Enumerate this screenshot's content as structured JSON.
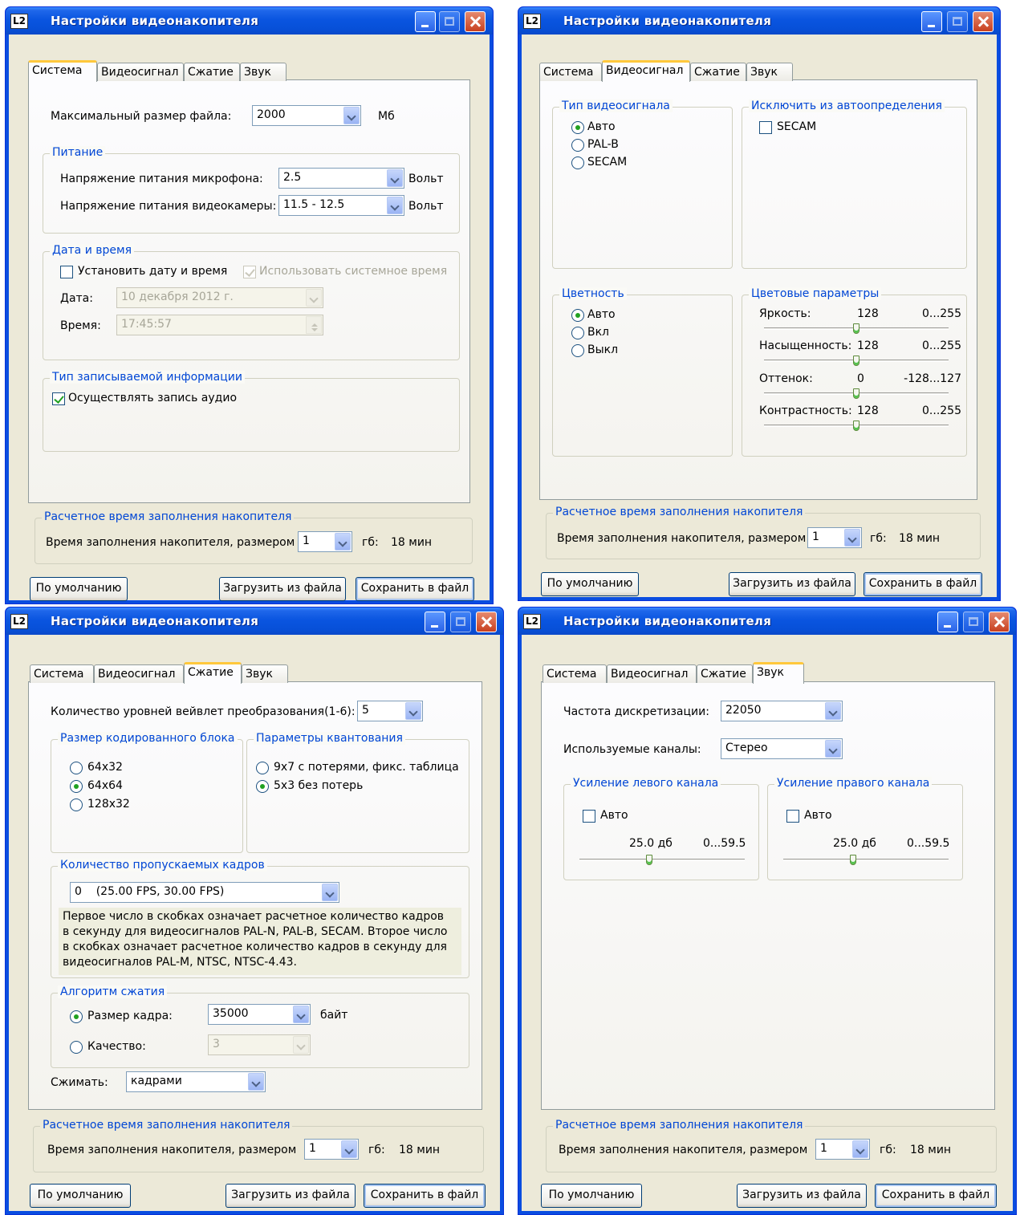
{
  "window": {
    "title": "Настройки видеонакопителя",
    "icon_label": "L2",
    "tabs": [
      "Система",
      "Видеосигнал",
      "Сжатие",
      "Звук"
    ]
  },
  "colors": {
    "titlebar": "#0a55e0",
    "group_title": "#0046d5",
    "face": "#ece9d8",
    "check": "#21a121"
  },
  "footer": {
    "group_title": "Расчетное время заполнения накопителя",
    "fill_label": "Время заполнения накопителя, размером",
    "size_value": "1",
    "unit": "гб:",
    "time": "18 мин",
    "btn_default": "По умолчанию",
    "btn_load": "Загрузить из файла",
    "btn_save": "Сохранить в файл"
  },
  "system": {
    "max_size_label": "Максимальный размер файла:",
    "max_size_value": "2000",
    "max_size_unit": "Мб",
    "power_group": "Питание",
    "mic_label": "Напряжение питания микрофона:",
    "mic_value": "2.5",
    "cam_label": "Напряжение питания видеокамеры:",
    "cam_value": "11.5 - 12.5",
    "volt": "Вольт",
    "datetime_group": "Дата и время",
    "set_datetime": "Установить дату и время",
    "use_system_time": "Использовать системное время",
    "date_label": "Дата:",
    "date_value": "10 декабря 2012 г.",
    "time_label": "Время:",
    "time_value": "17:45:57",
    "rec_group": "Тип записываемой информации",
    "rec_audio": "Осуществлять запись аудио"
  },
  "video": {
    "type_group": "Тип видеосигнала",
    "type_options": [
      "Авто",
      "PAL-B",
      "SECAM"
    ],
    "exclude_group": "Исключить из автоопределения",
    "exclude_secam": "SECAM",
    "chroma_group": "Цветность",
    "chroma_options": [
      "Авто",
      "Вкл",
      "Выкл"
    ],
    "color_group": "Цветовые параметры",
    "params": [
      {
        "label": "Яркость:",
        "value": "128",
        "range": "0...255",
        "level": 128,
        "min": 0,
        "max": 255
      },
      {
        "label": "Насыщенность:",
        "value": "128",
        "range": "0...255",
        "level": 128,
        "min": 0,
        "max": 255
      },
      {
        "label": "Оттенок:",
        "value": "0",
        "range": "-128...127",
        "level": 0,
        "min": -128,
        "max": 127
      },
      {
        "label": "Контрастность:",
        "value": "128",
        "range": "0...255",
        "level": 128,
        "min": 0,
        "max": 255
      }
    ]
  },
  "compression": {
    "levels_label": "Количество уровней вейвлет преобразования(1-6):",
    "levels_value": "5",
    "block_group": "Размер кодированного блока",
    "block_options": [
      "64x32",
      "64x64",
      "128x32"
    ],
    "quant_group": "Параметры квантования",
    "quant_options": [
      "9x7 с потерями, фикс. таблица",
      "5x3 без потерь"
    ],
    "skip_group": "Количество пропускаемых кадров",
    "skip_value": "0    (25.00 FPS, 30.00 FPS)",
    "note_lines": [
      "Первое число в скобках означает расчетное количество кадров",
      "в секунду для видеосигналов PAL-N, PAL-B, SECAM. Второе число",
      "в скобках означает расчетное количество кадров в секунду для",
      "видеосигналов PAL-M, NTSC, NTSC-4.43."
    ],
    "algo_group": "Алгоритм сжатия",
    "frame_size_label": "Размер кадра:",
    "frame_size_value": "35000",
    "frame_size_unit": "байт",
    "quality_label": "Качество:",
    "quality_value": "3",
    "compress_label": "Сжимать:",
    "compress_value": "кадрами"
  },
  "sound": {
    "rate_label": "Частота дискретизации:",
    "rate_value": "22050",
    "channels_label": "Используемые каналы:",
    "channels_value": "Стерео",
    "left_group": "Усиление левого канала",
    "right_group": "Усиление правого канала",
    "auto": "Авто",
    "gain_value": "25.0 дб",
    "gain_range": "0...59.5",
    "gain_level": 25.0,
    "gain_min": 0,
    "gain_max": 59.5
  }
}
